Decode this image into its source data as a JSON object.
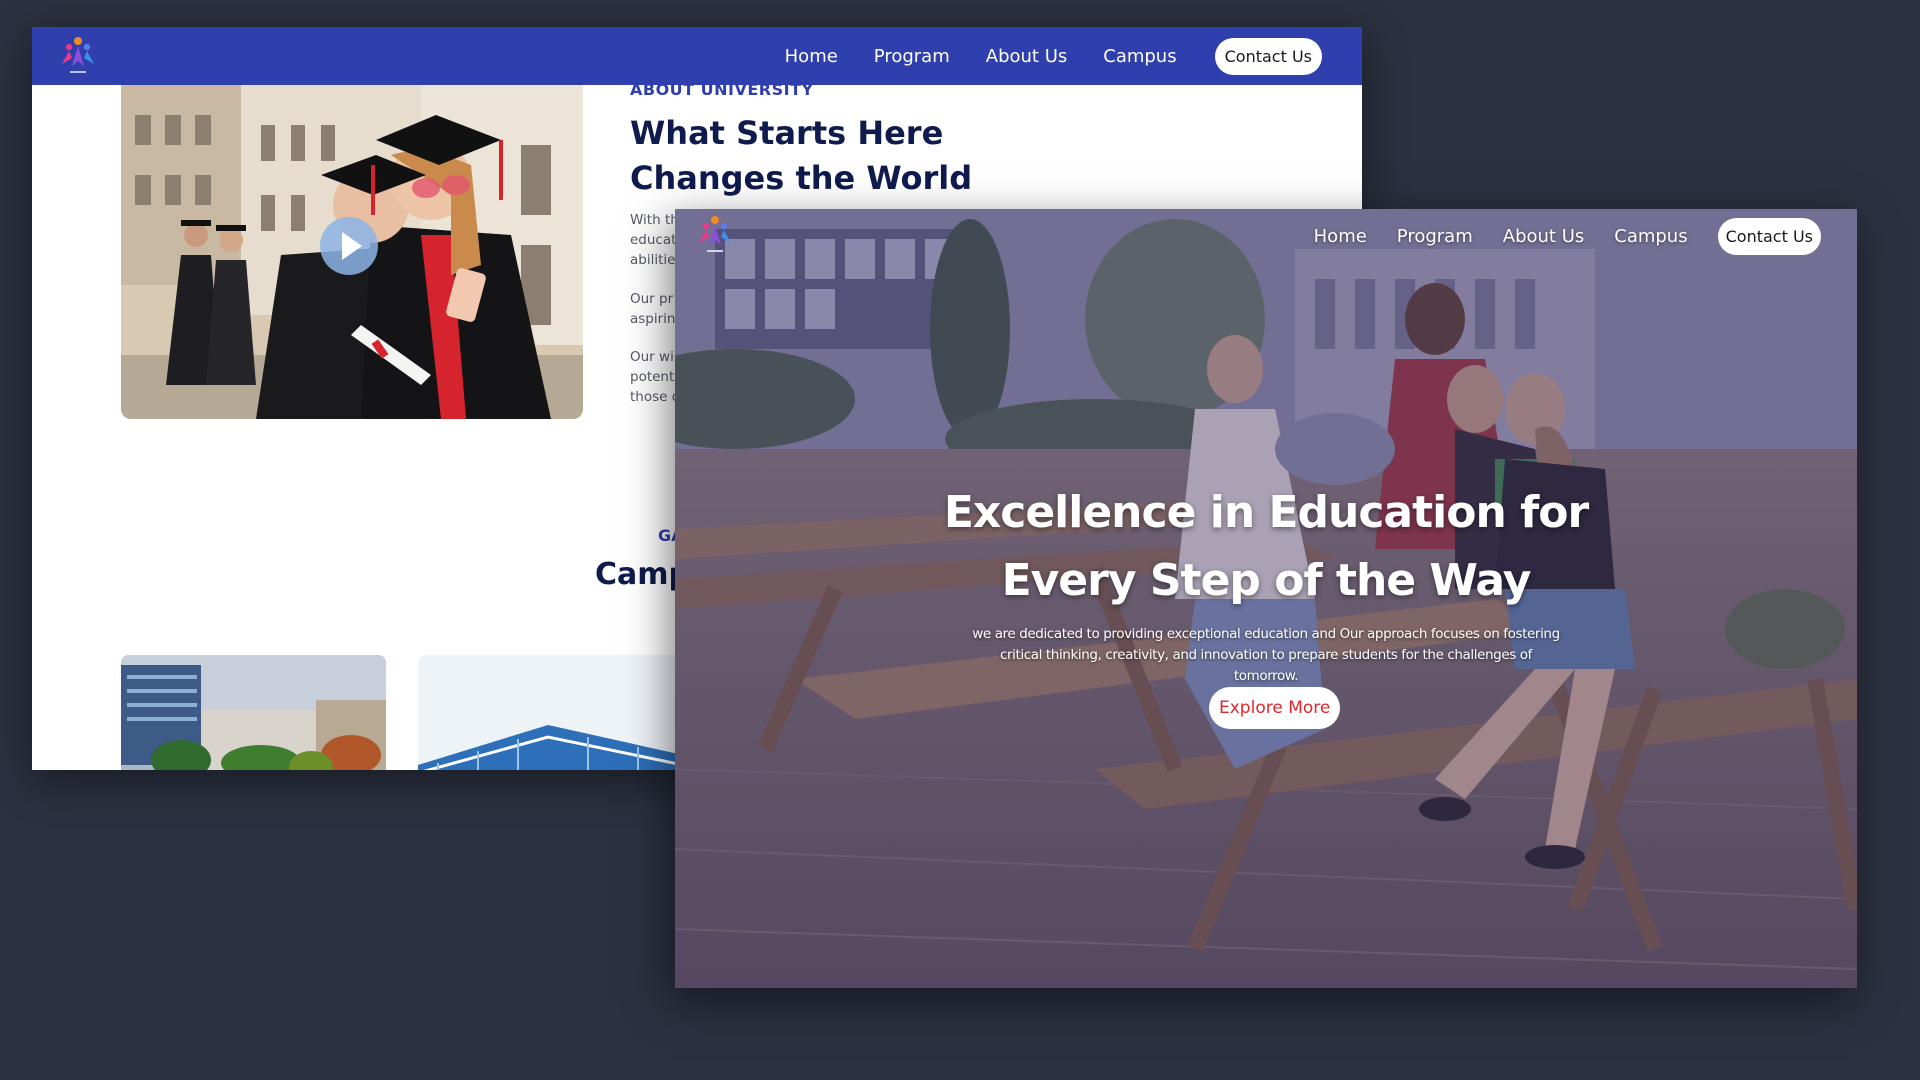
{
  "nav": {
    "links": [
      "Home",
      "Program",
      "About Us",
      "Campus"
    ],
    "contact_label": "Contact Us",
    "bar_color": "#2f3fad"
  },
  "about": {
    "eyebrow": "ABOUT UNIVERSITY",
    "title": "What Starts Here Changes the World",
    "para_fragments": [
      [
        "With th",
        "educat",
        "abilities"
      ],
      [
        "Our pr",
        "aspiring"
      ],
      [
        "Our wi",
        "potenti",
        "those o"
      ]
    ]
  },
  "gallery": {
    "eyebrow": "GA",
    "title": "Camp"
  },
  "hero": {
    "title": "Excellence in Education for Every Step of the Way",
    "subtitle": "we are dedicated to providing exceptional education and Our approach focuses on fostering critical thinking, creativity, and innovation to prepare students for the challenges of tomorrow.",
    "cta_label": "Explore More",
    "cta_color": "#e0262d"
  },
  "icons": {
    "logo": "university-logo-icon",
    "play": "play-icon"
  }
}
